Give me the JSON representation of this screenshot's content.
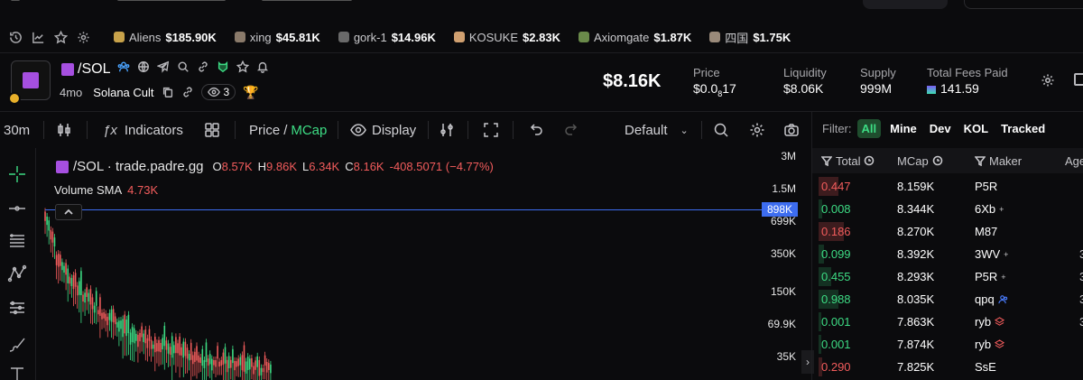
{
  "watchlist": [
    {
      "name": "Aliens",
      "price": "$185.90K",
      "color": "#c8a24a"
    },
    {
      "name": "xing",
      "price": "$45.81K",
      "color": "#8a7a6a"
    },
    {
      "name": "gork-1",
      "price": "$14.96K",
      "color": "#6a6a6a"
    },
    {
      "name": "KOSUKE",
      "price": "$2.83K",
      "color": "#d0a070"
    },
    {
      "name": "Axiomgate",
      "price": "$1.87K",
      "color": "#6a8a4a"
    },
    {
      "name": "四国",
      "price": "$1.75K",
      "color": "#9a8a7a"
    }
  ],
  "token": {
    "name": "/SOL",
    "age": "4mo",
    "community": "Solana Cult",
    "watchers": "3",
    "market_cap": "$8.16K",
    "stats": [
      {
        "label": "Price",
        "value_pre": "$0.0",
        "value_sub": "8",
        "value_post": "17"
      },
      {
        "label": "Liquidity",
        "value": "$8.06K"
      },
      {
        "label": "Supply",
        "value": "999M"
      },
      {
        "label": "Total Fees Paid",
        "value": "141.59"
      }
    ]
  },
  "toolbar": {
    "interval": "30m",
    "indicators": "Indicators",
    "price": "Price",
    "slash": "/",
    "mcap": "MCap",
    "display": "Display",
    "layout": "Default"
  },
  "legend": {
    "title": "/SOL · trade.padre.gg",
    "o_label": "O",
    "o": "8.57K",
    "h_label": "H",
    "h": "9.86K",
    "l_label": "L",
    "l": "6.34K",
    "c_label": "C",
    "c": "8.16K",
    "change": "-408.5071 (−4.77%)",
    "volume_label": "Volume SMA",
    "volume": "4.73K"
  },
  "price_scale": {
    "ticks": [
      "3M",
      "1.5M",
      "699K",
      "350K",
      "150K",
      "69.9K",
      "35K"
    ],
    "current": "898K"
  },
  "trades": {
    "filter_label": "Filter:",
    "filters": [
      "All",
      "Mine",
      "Dev",
      "KOL",
      "Tracked"
    ],
    "columns": {
      "total": "Total",
      "mcap": "MCap",
      "maker": "Maker",
      "age": "Age"
    },
    "rows": [
      {
        "total": "0.447",
        "side": "sell",
        "mcap": "8.159K",
        "maker": "P5R",
        "tag": "",
        "extra": ""
      },
      {
        "total": "0.008",
        "side": "buy",
        "mcap": "8.344K",
        "maker": "6Xb",
        "tag": "+",
        "extra": ""
      },
      {
        "total": "0.186",
        "side": "sell",
        "mcap": "8.270K",
        "maker": "M87",
        "tag": "",
        "extra": ""
      },
      {
        "total": "0.099",
        "side": "buy",
        "mcap": "8.392K",
        "maker": "3WV",
        "tag": "+",
        "extra": "3"
      },
      {
        "total": "0.455",
        "side": "buy",
        "mcap": "8.293K",
        "maker": "P5R",
        "tag": "+",
        "extra": "3"
      },
      {
        "total": "0.988",
        "side": "buy",
        "mcap": "8.035K",
        "maker": "qpq",
        "tag": "users",
        "extra": "3"
      },
      {
        "total": "0.001",
        "side": "buy",
        "mcap": "7.863K",
        "maker": "ryb",
        "tag": "layers",
        "extra": "3"
      },
      {
        "total": "0.001",
        "side": "buy",
        "mcap": "7.874K",
        "maker": "ryb",
        "tag": "layers",
        "extra": ""
      },
      {
        "total": "0.290",
        "side": "sell",
        "mcap": "7.825K",
        "maker": "SsE",
        "tag": "",
        "extra": ""
      }
    ]
  }
}
